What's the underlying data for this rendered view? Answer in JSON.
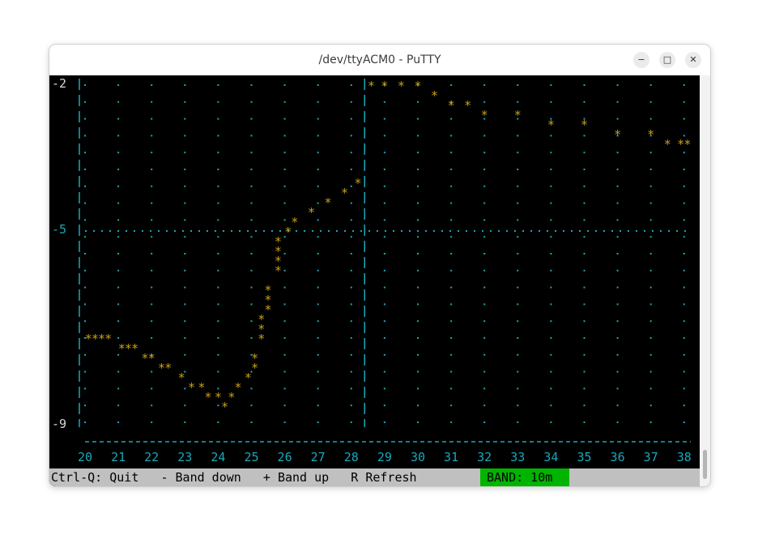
{
  "window": {
    "title": "/dev/ttyACM0 - PuTTY"
  },
  "window_controls": {
    "minimize": "−",
    "maximize": "□",
    "close": "✕"
  },
  "colors": {
    "axis": "#18a8b8",
    "trace": "#c8a018",
    "status_bg": "#c0c0c0",
    "band_bg": "#00b400",
    "terminal_bg": "#000000"
  },
  "plot": {
    "y_labels": [
      "-2",
      "-5",
      "-9"
    ],
    "x_labels": [
      "20",
      "21",
      "22",
      "23",
      "24",
      "25",
      "26",
      "27",
      "28",
      "29",
      "30",
      "31",
      "32",
      "33",
      "34",
      "35",
      "36",
      "37",
      "38"
    ]
  },
  "chart_data": {
    "type": "line",
    "title": "",
    "xlabel": "",
    "ylabel": "",
    "xlim": [
      20,
      38.2
    ],
    "ylim": [
      -9,
      -2
    ],
    "y_ticks": [
      -2,
      -5,
      -9
    ],
    "x_ticks": [
      20,
      21,
      22,
      23,
      24,
      25,
      26,
      27,
      28,
      29,
      30,
      31,
      32,
      33,
      34,
      35,
      36,
      37,
      38
    ],
    "vertical_markers": [
      28.4
    ],
    "series": [
      {
        "values_x": [
          20.1,
          20.3,
          20.5,
          20.7,
          21.1,
          21.3,
          21.5,
          21.8,
          22.0,
          22.3,
          22.5,
          22.9,
          23.2,
          23.5,
          23.7,
          24.0,
          24.2,
          24.4,
          24.6,
          24.9,
          25.1,
          25.1,
          25.3,
          25.3,
          25.3,
          25.5,
          25.5,
          25.5,
          25.8,
          25.8,
          25.8,
          25.8,
          26.1,
          26.3,
          26.8,
          27.3,
          27.8,
          28.2,
          28.6,
          29.0,
          29.5,
          30.0,
          30.5,
          31.0,
          31.5,
          32.0,
          33.0,
          34.0,
          35.0,
          36.0,
          37.0,
          37.5,
          37.9,
          38.1
        ],
        "values_y": [
          -7.2,
          -7.2,
          -7.2,
          -7.2,
          -7.4,
          -7.4,
          -7.4,
          -7.6,
          -7.6,
          -7.8,
          -7.8,
          -8.0,
          -8.2,
          -8.2,
          -8.4,
          -8.4,
          -8.6,
          -8.4,
          -8.2,
          -8.0,
          -7.8,
          -7.6,
          -7.2,
          -7.0,
          -6.8,
          -6.6,
          -6.4,
          -6.2,
          -5.8,
          -5.6,
          -5.4,
          -5.2,
          -5.0,
          -4.8,
          -4.6,
          -4.4,
          -4.2,
          -4.0,
          -2.0,
          -2.0,
          -2.0,
          -2.0,
          -2.2,
          -2.4,
          -2.4,
          -2.6,
          -2.6,
          -2.8,
          -2.8,
          -3.0,
          -3.0,
          -3.2,
          -3.2,
          -3.2
        ]
      }
    ]
  },
  "status": {
    "text": "Ctrl-Q: Quit   - Band down   + Band up   R Refresh",
    "band": "BAND: 10m"
  }
}
